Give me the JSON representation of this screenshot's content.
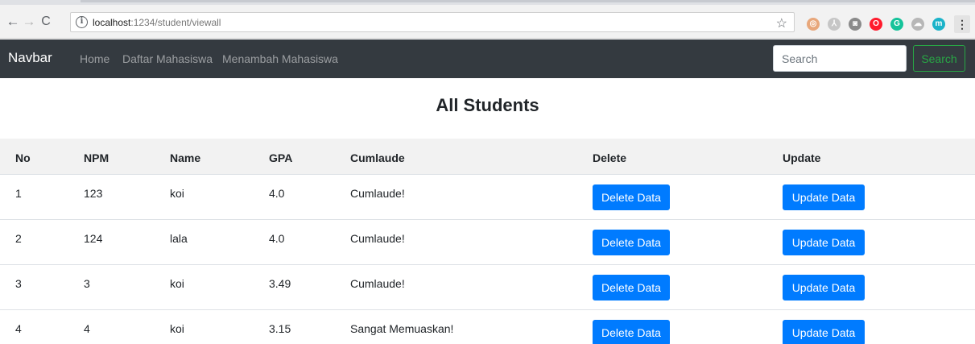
{
  "browser": {
    "url_host": "localhost",
    "url_path": ":1234/student/viewall",
    "extension_icons": [
      {
        "name": "cookie-icon",
        "color": "#e8a77b",
        "glyph": "◎"
      },
      {
        "name": "pdf-icon",
        "color": "#c6c6c6",
        "glyph": "⅄"
      },
      {
        "name": "camera-icon",
        "color": "#8a8a8a",
        "glyph": "◙"
      },
      {
        "name": "opera-icon",
        "color": "#ff1b2d",
        "glyph": "O"
      },
      {
        "name": "grammarly-icon",
        "color": "#15c39a",
        "glyph": "G"
      },
      {
        "name": "cloud-icon",
        "color": "#b7b7b7",
        "glyph": "☁"
      },
      {
        "name": "m-extension-icon",
        "color": "#1bb3c9",
        "glyph": "m"
      }
    ]
  },
  "navbar": {
    "brand": "Navbar",
    "links": [
      "Home",
      "Daftar Mahasiswa",
      "Menambah Mahasiswa"
    ],
    "search_placeholder": "Search",
    "search_button": "Search"
  },
  "page": {
    "title": "All Students"
  },
  "table": {
    "headers": {
      "no": "No",
      "npm": "NPM",
      "name": "Name",
      "gpa": "GPA",
      "cumlaude": "Cumlaude",
      "delete": "Delete",
      "update": "Update"
    },
    "rows": [
      {
        "no": "1",
        "npm": "123",
        "name": "koi",
        "gpa": "4.0",
        "cumlaude": "Cumlaude!",
        "delete": "Delete Data",
        "update": "Update Data"
      },
      {
        "no": "2",
        "npm": "124",
        "name": "lala",
        "gpa": "4.0",
        "cumlaude": "Cumlaude!",
        "delete": "Delete Data",
        "update": "Update Data"
      },
      {
        "no": "3",
        "npm": "3",
        "name": "koi",
        "gpa": "3.49",
        "cumlaude": "Cumlaude!",
        "delete": "Delete Data",
        "update": "Update Data"
      },
      {
        "no": "4",
        "npm": "4",
        "name": "koi",
        "gpa": "3.15",
        "cumlaude": "Sangat Memuaskan!",
        "delete": "Delete Data",
        "update": "Update Data"
      }
    ]
  },
  "colors": {
    "navbar_bg": "#343a40",
    "primary": "#007bff",
    "success": "#28a745"
  }
}
